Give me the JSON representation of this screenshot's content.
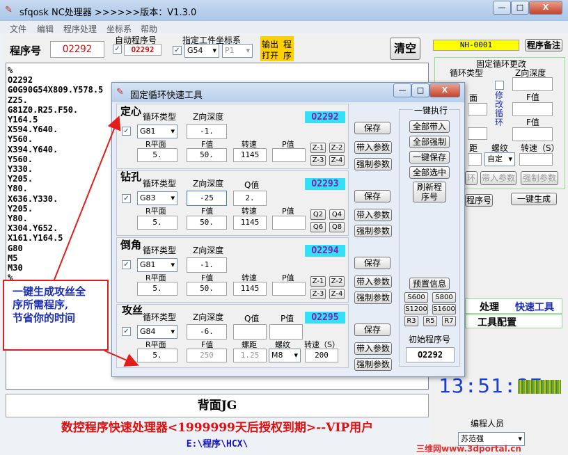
{
  "window": {
    "title": "sfqosk NC处理器 >>>>>>版本：V1.3.0",
    "minimize": "—",
    "maximize": "□",
    "close": "X"
  },
  "menu": [
    "文件",
    "编辑",
    "程序处理",
    "坐标系",
    "帮助"
  ],
  "toolbar": {
    "program_no_label": "程序号",
    "program_no": "O2292",
    "auto_label": "自动程序号",
    "auto_value": "O2292",
    "wcs_label": "指定工件坐标系",
    "wcs_value": "G54",
    "p_value": "P1",
    "io_btn_1": "输出",
    "io_btn_2": "打开",
    "io_btn_3": "程",
    "io_btn_4": "序",
    "clear_btn": "清空"
  },
  "editor": {
    "lines": [
      "%",
      "O2292",
      "G0G90G54X809.Y578.5",
      "Z25.",
      "G81Z0.R25.F50.",
      "Y164.5",
      "X594.Y640.",
      "Y560.",
      "X394.Y640.",
      "Y560.",
      "Y330.",
      "Y205.",
      "Y80.",
      "X636.Y330.",
      "Y205.",
      "Y80.",
      "X304.Y652.",
      "X161.Y164.5",
      "G80",
      "M5",
      "M30",
      "%"
    ]
  },
  "bottom": {
    "label": "背面JG",
    "footer": "数控程序快速处理器<1999999天后授权到期>--VIP用户",
    "path": "E:\\程序\\HCX\\"
  },
  "right": {
    "code": "NH-0001",
    "note_btn": "程序备注",
    "group_title": "固定循环更改",
    "cycle_type": "循环类型",
    "z_depth": "Z向深度",
    "f_value": "F值",
    "modify_cycle": "修改循环",
    "face": "面",
    "distance": "距",
    "thread": "螺纹",
    "speed": "转速（S）",
    "thread_value": "自定",
    "ring": "环",
    "bring_params": "带入参数",
    "force_params": "强制参数",
    "program_no_btn": "程序号",
    "one_click": "一键生成",
    "process": "处理",
    "quick_tools": "快速工具",
    "tool_config": "工具配置",
    "clock": "13:51:27",
    "programmer_label": "编程人员",
    "programmer": "苏范强",
    "watermark": "三维网www.3dportal.cn"
  },
  "dialog": {
    "title": "固定循环快速工具",
    "sections": [
      {
        "name": "定心",
        "cycle_label": "循环类型",
        "z_label": "Z向深度",
        "cycle": "G81",
        "z": "-1.",
        "prog": "O2292",
        "r_label": "R平面",
        "f_label": "F值",
        "s_label": "转速",
        "p_label": "P值",
        "r": "5.",
        "f": "50.",
        "s": "1145",
        "p": "",
        "codes": [
          "Z-1",
          "Z-2",
          "Z-3",
          "Z-4"
        ]
      },
      {
        "name": "钻孔",
        "cycle_label": "循环类型",
        "z_label": "Z向深度",
        "q_label": "Q值",
        "cycle": "G83",
        "z": "-25",
        "q": "2.",
        "prog": "O2293",
        "r_label": "R平面",
        "f_label": "F值",
        "s_label": "转速",
        "p_label": "P值",
        "r": "5.",
        "f": "50.",
        "s": "1145",
        "p": "",
        "codes": [
          "Q2",
          "Q4",
          "Q6",
          "Q8"
        ]
      },
      {
        "name": "倒角",
        "cycle_label": "循环类型",
        "z_label": "Z向深度",
        "cycle": "G81",
        "z": "-1.",
        "prog": "O2294",
        "r_label": "R平面",
        "f_label": "F值",
        "s_label": "转速",
        "p_label": "P值",
        "r": "5.",
        "f": "50.",
        "s": "1145",
        "p": "",
        "codes": [
          "Z-1",
          "Z-2",
          "Z-3",
          "Z-4"
        ]
      },
      {
        "name": "攻丝",
        "cycle_label": "循环类型",
        "z_label": "Z向深度",
        "q_label": "Q值",
        "p_label": "P值",
        "cycle": "G84",
        "z": "-6.",
        "prog": "O2295",
        "r_label": "R平面",
        "f_label": "F值",
        "pitch_label": "螺距",
        "thread_label": "螺纹",
        "s_label": "转速（S）",
        "r": "5.",
        "f": "250",
        "pitch": "1.25",
        "thread": "M8",
        "s": "200"
      }
    ],
    "buttons": {
      "save": "保存",
      "bring": "带入参数",
      "force": "强制参数"
    },
    "exec": {
      "title": "一键执行",
      "all_bring": "全部带入",
      "all_force": "全部强制",
      "one_save": "一键保存",
      "select_all": "全部选中",
      "refresh_1": "刷新程",
      "refresh_2": "序号",
      "preset": "预置信息",
      "speeds": [
        "S600",
        "S800",
        "S1200",
        "S1600"
      ],
      "rs": [
        "R3",
        "R5",
        "R7"
      ],
      "init_label": "初始程序号",
      "init_value": "O2292"
    }
  },
  "callout": {
    "line1": "一键生成攻丝全",
    "line2": "序所需程序,",
    "line3": "节省你的时间"
  }
}
